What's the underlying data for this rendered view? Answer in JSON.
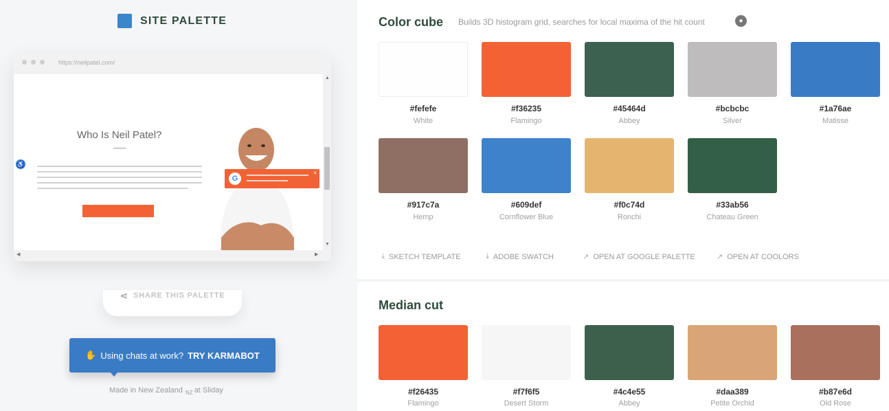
{
  "brand": {
    "name": "SITE PALETTE",
    "accent": "#3a86c9"
  },
  "preview": {
    "url": "https://neilpatel.com/",
    "site_title": "Who Is Neil Patel?",
    "accent": "#f36235"
  },
  "share": {
    "label": "SHARE THIS PALETTE",
    "icon": "share-icon"
  },
  "promo": {
    "emoji": "✋",
    "text": "Using chats at work?",
    "cta": "TRY KARMABOT"
  },
  "footer": {
    "made_in": "Made in New Zealand",
    "flag": "NZ",
    "at": "at Sliday"
  },
  "color_cube": {
    "title": "Color cube",
    "subtitle": "Builds 3D histogram grid, searches for local maxima of the hit count",
    "icon": "github-icon",
    "colors": [
      {
        "hex": "#fefefe",
        "name": "White"
      },
      {
        "hex": "#f36235",
        "name": "Flamingo"
      },
      {
        "hex": "#45464d",
        "name": "Abbey"
      },
      {
        "hex": "#bcbcbc",
        "name": "Silver"
      },
      {
        "hex": "#1a76ae",
        "name": "Matisse"
      },
      {
        "hex": "#917c7a",
        "name": "Hemp"
      },
      {
        "hex": "#609def",
        "name": "Cornflower Blue"
      },
      {
        "hex": "#f0c74d",
        "name": "Ronchi"
      },
      {
        "hex": "#33ab56",
        "name": "Chateau Green"
      }
    ],
    "actions": [
      "SKETCH TEMPLATE",
      "ADOBE SWATCH",
      "OPEN AT GOOGLE PALETTE",
      "OPEN AT COOLORS"
    ]
  },
  "median_cut": {
    "title": "Median cut",
    "colors": [
      {
        "hex": "#f26435",
        "name": "Flamingo"
      },
      {
        "hex": "#f7f6f5",
        "name": "Desert Storm"
      },
      {
        "hex": "#4c4e55",
        "name": "Abbey"
      },
      {
        "hex": "#daa389",
        "name": "Petite Orchid"
      },
      {
        "hex": "#b87e6d",
        "name": "Old Rose"
      }
    ]
  },
  "display_swatches": {
    "color_cube": [
      "#fefefe",
      "#f36235",
      "#3d6150",
      "#bebcbd",
      "#3a7bc5",
      "#8f6f63",
      "#3e82cc",
      "#e5b56f",
      "#345f47"
    ],
    "median_cut": [
      "#f36235",
      "#f6f6f6",
      "#3c604c",
      "#d9a576",
      "#a8705d"
    ]
  }
}
